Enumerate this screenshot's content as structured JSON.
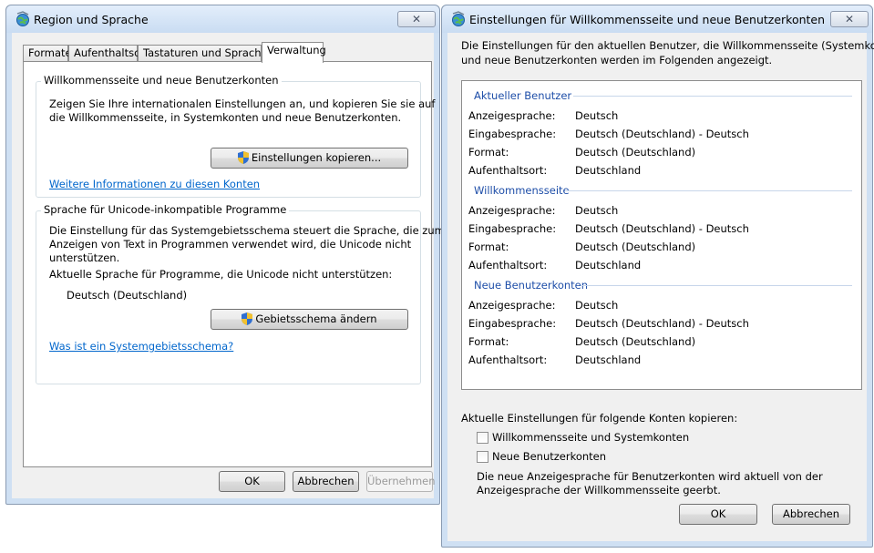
{
  "left_window": {
    "title": "Region und Sprache",
    "close_label": "✕",
    "tabs": [
      "Formate",
      "Aufenthaltsort",
      "Tastaturen und Sprachen",
      "Verwaltung"
    ],
    "active_tab": "Verwaltung",
    "welcome_group": {
      "title": "Willkommensseite und neue Benutzerkonten",
      "description_line1": "Zeigen Sie Ihre internationalen Einstellungen an, und kopieren Sie sie auf",
      "description_line2": "die Willkommensseite, in Systemkonten und neue Benutzerkonten.",
      "copy_button": "Einstellungen kopieren...",
      "more_info_link": "Weitere Informationen zu diesen Konten"
    },
    "unicode_group": {
      "title": "Sprache für Unicode-inkompatible Programme",
      "description_line1": "Die Einstellung für das Systemgebietsschema steuert die Sprache, die zum",
      "description_line2": "Anzeigen von Text in Programmen verwendet wird, die Unicode nicht",
      "description_line3": "unterstützen.",
      "current_label": "Aktuelle Sprache für Programme, die Unicode nicht unterstützen:",
      "current_value": "Deutsch (Deutschland)",
      "change_button": "Gebietsschema ändern",
      "what_is_link": "Was ist ein Systemgebietsschema?"
    },
    "buttons": {
      "ok": "OK",
      "cancel": "Abbrechen",
      "apply": "Übernehmen"
    }
  },
  "right_window": {
    "title": "Einstellungen für Willkommensseite und neue Benutzerkonten",
    "close_label": "✕",
    "intro_line1": "Die Einstellungen für den aktuellen Benutzer, die Willkommensseite (Systemkonten)",
    "intro_line2": "und neue Benutzerkonten werden im Folgenden angezeigt.",
    "sections": [
      {
        "title": "Aktueller Benutzer",
        "rows": [
          {
            "label": "Anzeigesprache:",
            "value": "Deutsch"
          },
          {
            "label": "Eingabesprache:",
            "value": "Deutsch (Deutschland) - Deutsch"
          },
          {
            "label": "Format:",
            "value": "Deutsch (Deutschland)"
          },
          {
            "label": "Aufenthaltsort:",
            "value": "Deutschland"
          }
        ]
      },
      {
        "title": "Willkommensseite",
        "rows": [
          {
            "label": "Anzeigesprache:",
            "value": "Deutsch"
          },
          {
            "label": "Eingabesprache:",
            "value": "Deutsch (Deutschland) - Deutsch"
          },
          {
            "label": "Format:",
            "value": "Deutsch (Deutschland)"
          },
          {
            "label": "Aufenthaltsort:",
            "value": "Deutschland"
          }
        ]
      },
      {
        "title": "Neue Benutzerkonten",
        "rows": [
          {
            "label": "Anzeigesprache:",
            "value": "Deutsch"
          },
          {
            "label": "Eingabesprache:",
            "value": "Deutsch (Deutschland) - Deutsch"
          },
          {
            "label": "Format:",
            "value": "Deutsch (Deutschland)"
          },
          {
            "label": "Aufenthaltsort:",
            "value": "Deutschland"
          }
        ]
      }
    ],
    "copy_label": "Aktuelle Einstellungen für folgende Konten kopieren:",
    "checkboxes": [
      {
        "label": "Willkommensseite und Systemkonten",
        "checked": false
      },
      {
        "label": "Neue Benutzerkonten",
        "checked": false
      }
    ],
    "note_line1": "Die neue Anzeigesprache für Benutzerkonten wird aktuell von der",
    "note_line2": "Anzeigesprache der Willkommensseite geerbt.",
    "buttons": {
      "ok": "OK",
      "cancel": "Abbrechen"
    }
  },
  "colors": {
    "link": "#0066cc",
    "section_heading": "#1e4ea8",
    "titlebar": "#c9dcf2"
  },
  "icons": {
    "window": "globe-icon",
    "elevation": "uac-shield-icon"
  }
}
